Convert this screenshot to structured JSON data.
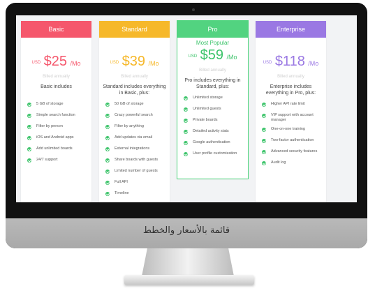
{
  "caption": "قائمة بالأسعار والخطط",
  "colors": {
    "basic": "#f5576c",
    "standard": "#f6b82a",
    "pro": "#52d380",
    "enterprise": "#9a78e3"
  },
  "plans": [
    {
      "name": "Basic",
      "popular": "",
      "currency": "USD",
      "amount": "$25",
      "period": "/Mo",
      "billed": "Billed annually",
      "includes": "Basic includes",
      "features": [
        "5 GB of storage",
        "Simple search function",
        "Filter by person",
        "iOS and Android apps",
        "Add unlimited boards",
        "24/7 support"
      ]
    },
    {
      "name": "Standard",
      "popular": "",
      "currency": "USD",
      "amount": "$39",
      "period": "/Mo",
      "billed": "Billed annually",
      "includes": "Standard includes everything in Basic, plus:",
      "features": [
        "50 GB of storage",
        "Crazy powerful search",
        "Filter by anything",
        "Add updates via email",
        "External integrations",
        "Share boards with guests",
        "Limited number of guests",
        "Full API",
        "Timeline"
      ]
    },
    {
      "name": "Pro",
      "popular": "Most Popular",
      "currency": "USD",
      "amount": "$59",
      "period": "/Mo",
      "billed": "Billed annually",
      "includes": "Pro includes everything in Standard, plus:",
      "features": [
        "Unlimited storage",
        "Unlimited guests",
        "Private boards",
        "Detailed activity stats",
        "Google authentication",
        "User profile customization"
      ]
    },
    {
      "name": "Enterprise",
      "popular": "",
      "currency": "USD",
      "amount": "$118",
      "period": "/Mo",
      "billed": "Billed annually",
      "includes": "Enterprise includes everything in Pro, plus:",
      "features": [
        "Higher API rate limit",
        "VIP support with account manager",
        "One-on-one training",
        "Two-factor authentication",
        "Advanced security features",
        "Audit log"
      ]
    }
  ]
}
